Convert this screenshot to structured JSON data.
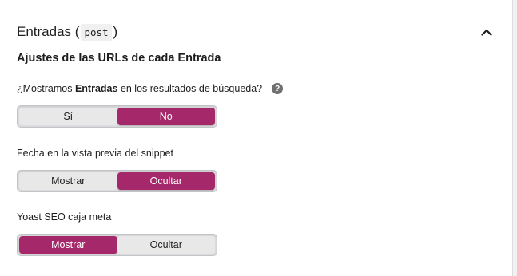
{
  "panel": {
    "title": "Entradas (",
    "code": "post",
    "title_close": ")"
  },
  "section_title": "Ajustes de las URLs de cada Entrada",
  "fields": [
    {
      "label_pre": "¿Mostramos ",
      "label_bold": "Entradas",
      "label_post": " en los resultados de búsqueda?",
      "help": "?",
      "options": [
        "Sí",
        "No"
      ],
      "selected": "No"
    },
    {
      "label": "Fecha en la vista previa del snippet",
      "options": [
        "Mostrar",
        "Ocultar"
      ],
      "selected": "Ocultar"
    },
    {
      "label": "Yoast SEO caja meta",
      "options": [
        "Mostrar",
        "Ocultar"
      ],
      "selected": "Mostrar"
    }
  ],
  "colors": {
    "accent": "#a4286a",
    "toggle_bg": "#dcdcde"
  },
  "icons": {
    "collapse": "chevron-up-icon",
    "help": "help-icon"
  }
}
